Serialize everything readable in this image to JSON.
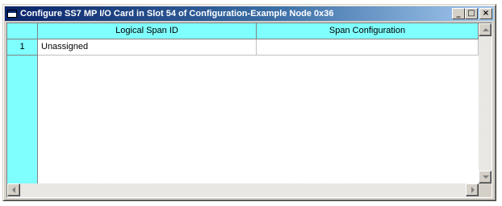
{
  "window": {
    "title": "Configure SS7 MP I/O Card in Slot 54 of Configuration-Example Node 0x36",
    "minimize_glyph": "_",
    "maximize_glyph": "□",
    "close_glyph": "×"
  },
  "grid": {
    "columns": [
      "Logical Span ID",
      "Span Configuration"
    ],
    "rows": [
      {
        "number": "1",
        "cells": [
          "Unassigned",
          ""
        ]
      }
    ]
  },
  "colors": {
    "header_bg": "#80ffff",
    "titlebar_start": "#0a246a",
    "titlebar_end": "#a6caf0"
  },
  "icons": [
    "app-window-icon",
    "minimize-icon",
    "maximize-icon",
    "close-icon",
    "scroll-up-icon",
    "scroll-down-icon",
    "scroll-left-icon",
    "scroll-right-icon"
  ]
}
